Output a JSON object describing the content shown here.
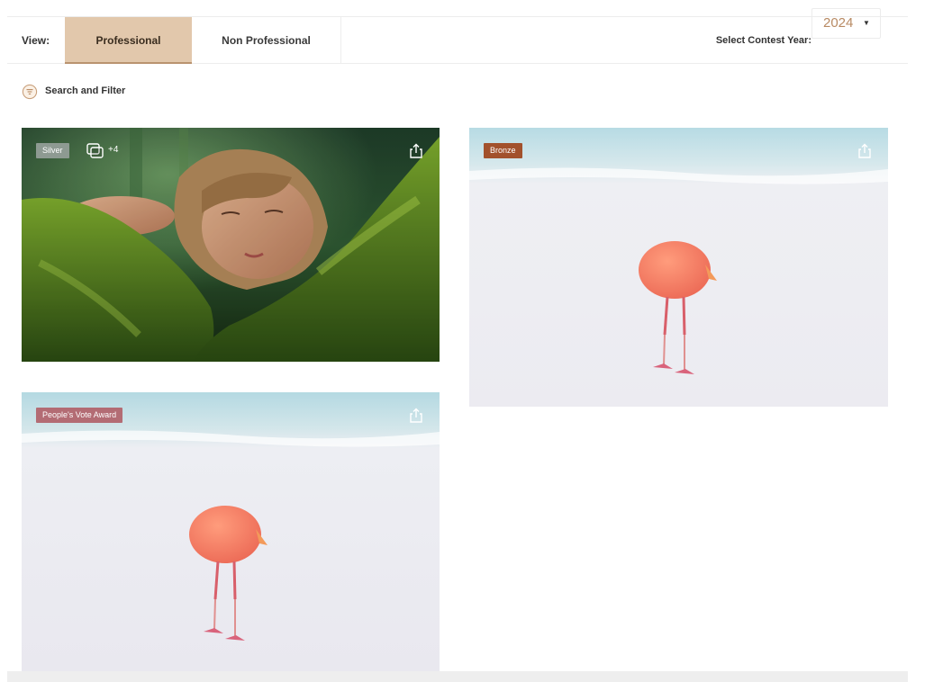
{
  "view": {
    "label": "View:",
    "tabs": [
      {
        "label": "Professional",
        "active": true
      },
      {
        "label": "Non Professional",
        "active": false
      }
    ]
  },
  "contest_year": {
    "label": "Select Contest Year:",
    "value": "2024"
  },
  "filter": {
    "label": "Search and Filter",
    "icon": "filter-icon"
  },
  "cards": [
    {
      "badge": "Silver",
      "badge_color": "#8e9a92",
      "extra_count": "+4",
      "subject": "woman resting on mossy tree trunk"
    },
    {
      "badge": "Bronze",
      "badge_color": "#a2512c",
      "subject": "flamingo on white sand beach"
    },
    {
      "badge": "People's Vote Award",
      "badge_color": "#b36c74",
      "subject": "flamingo on white sand beach"
    }
  ],
  "colors": {
    "accent": "#e2c8ac",
    "year": "#b88a63"
  }
}
